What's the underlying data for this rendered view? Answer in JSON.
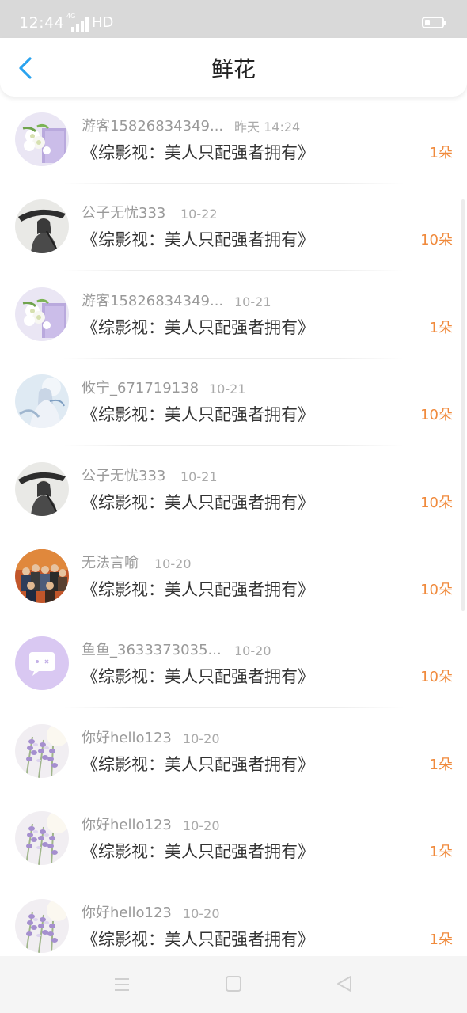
{
  "status_bar": {
    "time": "12:44",
    "network": "4G",
    "hd": "HD",
    "battery_level": 0.3
  },
  "header": {
    "title": "鲜花",
    "back_icon": "chevron-left-icon",
    "accent_color": "#2aa3ef"
  },
  "colors": {
    "count": "#f08a3c",
    "name": "#999999",
    "title": "#333333"
  },
  "rows": [
    {
      "name": "游客15826834349...",
      "time": "昨天 14:24",
      "book": "《综影视：美人只配强者拥有》",
      "count": "1朵",
      "avatar": "flowers-purple"
    },
    {
      "name": "公子无忧333",
      "time": "10-22",
      "book": "《综影视：美人只配强者拥有》",
      "count": "10朵",
      "avatar": "ink-swordsman"
    },
    {
      "name": "游客15826834349...",
      "time": "10-21",
      "book": "《综影视：美人只配强者拥有》",
      "count": "1朵",
      "avatar": "flowers-purple"
    },
    {
      "name": "攸宁_671719138",
      "time": "10-21",
      "book": "《综影视：美人只配强者拥有》",
      "count": "10朵",
      "avatar": "fairy-blue"
    },
    {
      "name": "公子无忧333",
      "time": "10-21",
      "book": "《综影视：美人只配强者拥有》",
      "count": "10朵",
      "avatar": "ink-swordsman"
    },
    {
      "name": "无法言喻",
      "time": "10-20",
      "book": "《综影视：美人只配强者拥有》",
      "count": "10朵",
      "avatar": "group-photo"
    },
    {
      "name": "鱼鱼_3633373035...",
      "time": "10-20",
      "book": "《综影视：美人只配强者拥有》",
      "count": "10朵",
      "avatar": "default-chat"
    },
    {
      "name": "你好hello123",
      "time": "10-20",
      "book": "《综影视：美人只配强者拥有》",
      "count": "1朵",
      "avatar": "lavender"
    },
    {
      "name": "你好hello123",
      "time": "10-20",
      "book": "《综影视：美人只配强者拥有》",
      "count": "1朵",
      "avatar": "lavender"
    },
    {
      "name": "你好hello123",
      "time": "10-20",
      "book": "《综影视：美人只配强者拥有》",
      "count": "1朵",
      "avatar": "lavender"
    }
  ],
  "nav_bar": {
    "menu_icon": "menu-icon",
    "home_icon": "home-square-icon",
    "back_icon": "back-triangle-icon"
  }
}
